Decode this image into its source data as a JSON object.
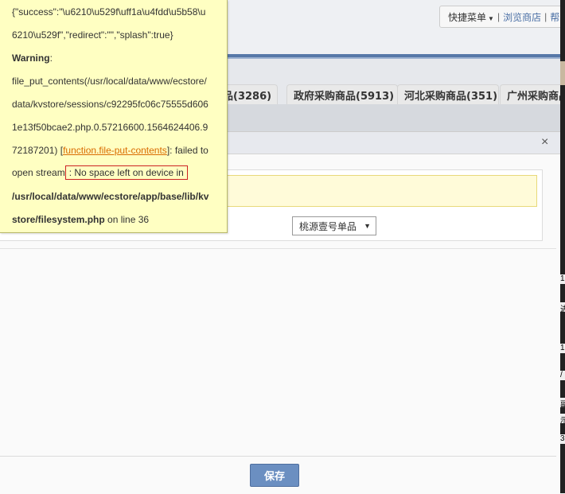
{
  "header": {
    "quick_menu": "快捷菜单",
    "separator": "|",
    "browse_store": "浏览商店",
    "truncated_link": "帮"
  },
  "tabs": [
    {
      "label": "品(3286)"
    },
    {
      "label": "政府采购商品(5913)"
    },
    {
      "label": "河北采购商品(351)"
    },
    {
      "label": "广州采购商品"
    }
  ],
  "dialog": {
    "close_glyph": "×",
    "select_value": "桃源壹号单品",
    "select_arrow": "▼",
    "save_label": "保存"
  },
  "error_popup": {
    "line1": "{\"success\":\"\\u6210\\u529f\\uff1a\\u4fdd\\u5b58\\u",
    "line2": "6210\\u529f\",\"redirect\":\"\",\"splash\":true}",
    "warning_label": "Warning",
    "warning_colon": ":",
    "line4": "file_put_contents(/usr/local/data/www/ecstore/",
    "line5": "data/kvstore/sessions/c92295fc06c75555d606",
    "line6": "1e13f50bcae2.php.0.57216600.1564624406.9",
    "line7_pre": "72187201) [",
    "line7_link": "function.file-put-contents",
    "line7_post": "]: failed to",
    "line8_pre": "open stream",
    "line8_boxed": ": No space left on device in",
    "line9": "/usr/local/data/www/ecstore/app/base/lib/kv",
    "line10_bold": "store/filesystem.php",
    "line10_post": " on line 36"
  },
  "right_edge": [
    "1",
    "进",
    "1",
    "/",
    "副",
    "示",
    "3"
  ]
}
